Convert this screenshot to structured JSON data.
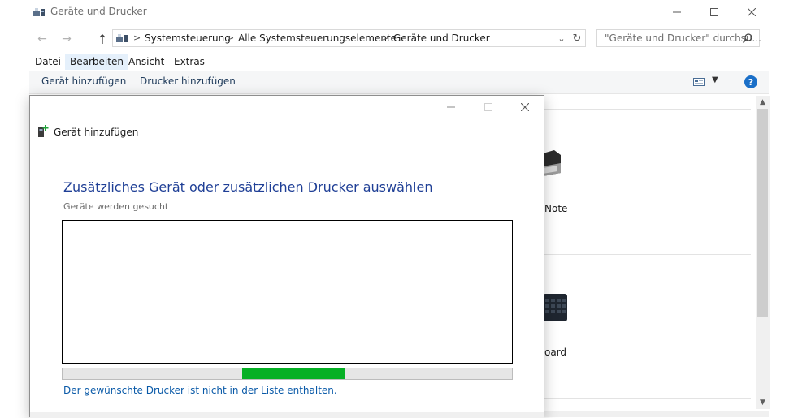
{
  "window": {
    "title": "Geräte und Drucker",
    "breadcrumb": [
      "Systemsteuerung",
      "Alle Systemsteuerungselemente",
      "Geräte und Drucker"
    ],
    "search_placeholder": "\"Geräte und Drucker\" durchsu...",
    "menu": [
      "Datei",
      "Bearbeiten",
      "Ansicht",
      "Extras"
    ],
    "commands": [
      "Gerät hinzufügen",
      "Drucker hinzufügen"
    ],
    "help_label": "?"
  },
  "background_devices": [
    {
      "label": "Note",
      "icon": "printer-icon"
    },
    {
      "label": "oard",
      "icon": "keyboard-icon"
    }
  ],
  "dialog": {
    "app_title": "Gerät hinzufügen",
    "heading": "Zusätzliches Gerät oder zusätzlichen Drucker auswählen",
    "status": "Geräte werden gesucht",
    "progress_fraction_start": 0.4,
    "progress_fraction_end": 0.627,
    "link": "Der gewünschte Drucker ist nicht in der Liste enthalten.",
    "accent_color": "#06b025"
  },
  "colors": {
    "heading_blue": "#1f3f96",
    "link_blue": "#0a5aa8",
    "help_blue": "#1a6fc8"
  }
}
